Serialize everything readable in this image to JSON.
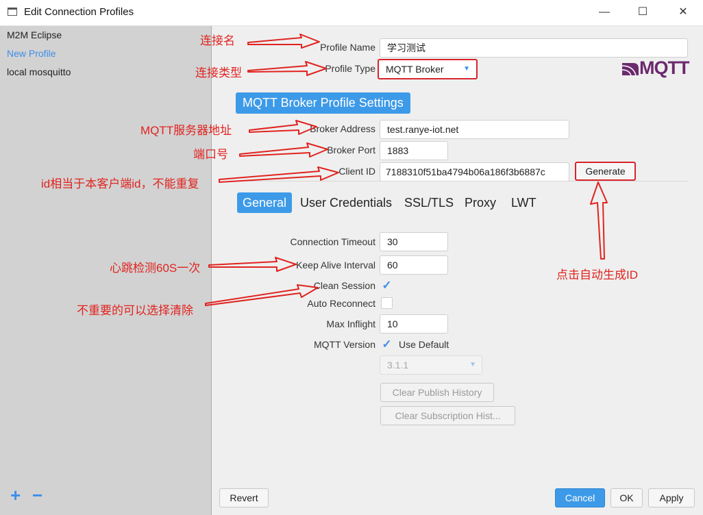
{
  "window": {
    "title": "Edit Connection Profiles",
    "minimize": "—",
    "maximize": "☐",
    "close": "✕"
  },
  "sidebar": {
    "items": [
      {
        "label": "M2M Eclipse"
      },
      {
        "label": "New Profile"
      },
      {
        "label": "local mosquitto"
      }
    ],
    "add": "+",
    "remove": "−"
  },
  "form": {
    "profile_name": {
      "label": "Profile Name",
      "value": "学习测试"
    },
    "profile_type": {
      "label": "Profile Type",
      "value": "MQTT Broker"
    },
    "logo_text": "MQTT",
    "section_title": "MQTT Broker Profile Settings",
    "broker_address": {
      "label": "Broker Address",
      "value": "test.ranye-iot.net"
    },
    "broker_port": {
      "label": "Broker Port",
      "value": "1883"
    },
    "client_id": {
      "label": "Client ID",
      "value": "7188310f51ba4794b06a186f3b6887c"
    },
    "generate": "Generate"
  },
  "tabs": [
    "General",
    "User Credentials",
    "SSL/TLS",
    "Proxy",
    "LWT"
  ],
  "general": {
    "connection_timeout": {
      "label": "Connection Timeout",
      "value": "30"
    },
    "keep_alive": {
      "label": "Keep Alive Interval",
      "value": "60"
    },
    "clean_session": {
      "label": "Clean Session",
      "checked": true
    },
    "auto_reconnect": {
      "label": "Auto Reconnect",
      "checked": false
    },
    "max_inflight": {
      "label": "Max Inflight",
      "value": "10"
    },
    "mqtt_version": {
      "label": "MQTT Version",
      "use_default": "Use Default",
      "value": "3.1.1"
    },
    "clear_publish": "Clear Publish History",
    "clear_subscription": "Clear Subscription Hist..."
  },
  "footer": {
    "revert": "Revert",
    "cancel": "Cancel",
    "ok": "OK",
    "apply": "Apply"
  },
  "annotations": {
    "name": "连接名",
    "type": "连接类型",
    "server": "MQTT服务器地址",
    "port": "端口号",
    "clientid": "id相当于本客户端id，不能重复",
    "keepalive": "心跳检测60S一次",
    "clean": "不重要的可以选择清除",
    "generate": "点击自动生成ID"
  },
  "colors": {
    "accent": "#3d9ae8",
    "annotation": "#e0231f"
  }
}
